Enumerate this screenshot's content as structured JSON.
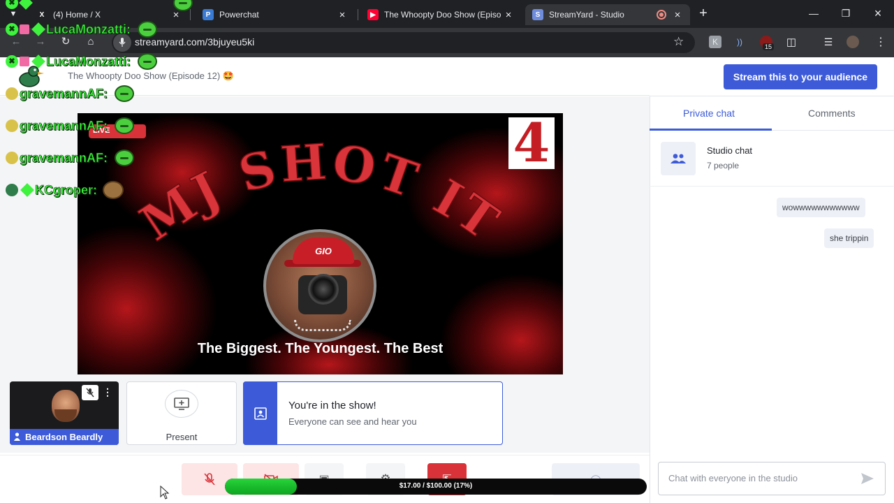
{
  "browser": {
    "tabs": [
      {
        "label": "(4) Home / X",
        "icon": "x-logo-icon"
      },
      {
        "label": "Powerchat",
        "icon": "powerchat-icon"
      },
      {
        "label": "The Whoopty Doo Show (Episo",
        "icon": "youtube-icon"
      },
      {
        "label": "StreamYard - Studio",
        "icon": "streamyard-icon",
        "recording": true
      }
    ],
    "url": "streamyard.com/3bjuyeu5ki",
    "extension_badge": "15"
  },
  "overlay_chat": [
    {
      "name": "LucaMonzatti:"
    },
    {
      "name": "LucaMonzatti:"
    },
    {
      "name": "gravemannAF:"
    },
    {
      "name": "gravemannAF:"
    },
    {
      "name": "gravemannAF:"
    },
    {
      "name": "KCgroper:"
    }
  ],
  "header": {
    "show_title": "The Whoopty Doo Show (Episode 12) 🤩",
    "stream_button": "Stream this to your audience"
  },
  "video": {
    "live_label": "LIVE",
    "headline": "MJ SHOT IT",
    "channel_badge": "4",
    "tagline": "The Biggest. The Youngest. The Best",
    "cap_text": "GIO"
  },
  "participants": {
    "name": "Beardson Beardly",
    "present_label": "Present",
    "in_show_title": "You're in the show!",
    "in_show_subtitle": "Everyone can see and hear you"
  },
  "donation": {
    "text": "$17.00 / $100.00 (17%)",
    "progress": 0.17
  },
  "chat_panel": {
    "tabs": [
      "Private chat",
      "Comments"
    ],
    "active_tab": "Private chat",
    "studio_chat_title": "Studio chat",
    "studio_chat_people": "7 people",
    "messages": [
      "wowwwwwwwwwww",
      "she trippin"
    ],
    "input_placeholder": "Chat with everyone in the studio"
  },
  "colors": {
    "accent": "#3d5bd9",
    "live_red": "#d93238",
    "overlay_green": "#3ef23e"
  }
}
